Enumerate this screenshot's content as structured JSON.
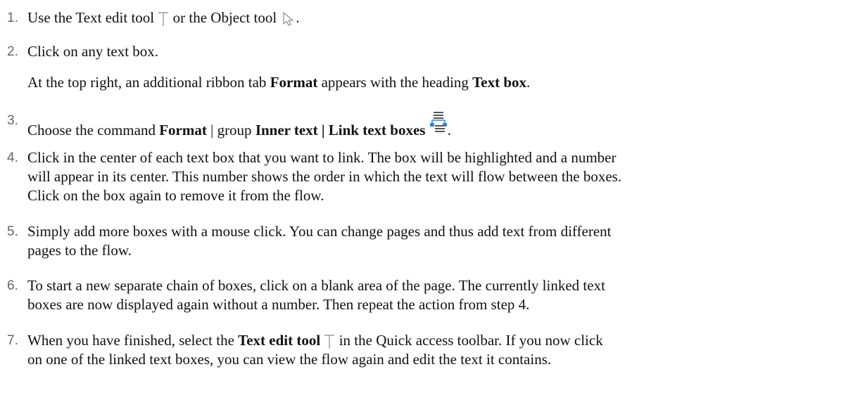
{
  "steps": [
    {
      "number": "1.",
      "parts": [
        "Use the Text edit tool",
        "or the Object tool",
        "."
      ],
      "icons": [
        "text-edit-tool-icon",
        "object-tool-arrow-icon"
      ]
    },
    {
      "number": "2.",
      "parts": [
        "Click on any text box."
      ],
      "note": {
        "t1": "At the top right, an additional ribbon tab ",
        "b1": "Format",
        "t2": " appears with the heading ",
        "b2": "Text box",
        "t3": "."
      }
    },
    {
      "number": "3.",
      "t1": "Choose the command ",
      "b1": "Format",
      "t2": " | group ",
      "b2": "Inner text | Link text boxes",
      "t3": ".",
      "icon": "link-text-boxes-icon"
    },
    {
      "number": "4.",
      "lines": [
        "Click in the center of each text box that you want to link. The box will be highlighted and a number",
        "will appear in its center. This number shows the order in which the text will flow between the boxes.",
        "Click on the box again to remove it from the flow."
      ]
    },
    {
      "number": "5.",
      "lines": [
        "Simply add more boxes with a mouse click. You can change pages and thus add text from different",
        "pages to the flow."
      ]
    },
    {
      "number": "6.",
      "lines": [
        "To start a new separate chain of boxes, click on a blank area of the page. The currently linked text",
        "boxes are now displayed again without a number. Then repeat the action from step 4."
      ]
    },
    {
      "number": "7.",
      "t1": "When you have finished, select the ",
      "b1": "Text edit tool",
      "t2": " in the Quick access toolbar. If you now click",
      "line2": "on one of the linked text boxes, you can view the flow again and edit the text it contains.",
      "icon": "text-edit-tool-icon"
    }
  ],
  "colors": {
    "text": "#111111",
    "number": "#666666",
    "icon_gray": "#9a9a9a",
    "icon_blue": "#2e86de"
  }
}
